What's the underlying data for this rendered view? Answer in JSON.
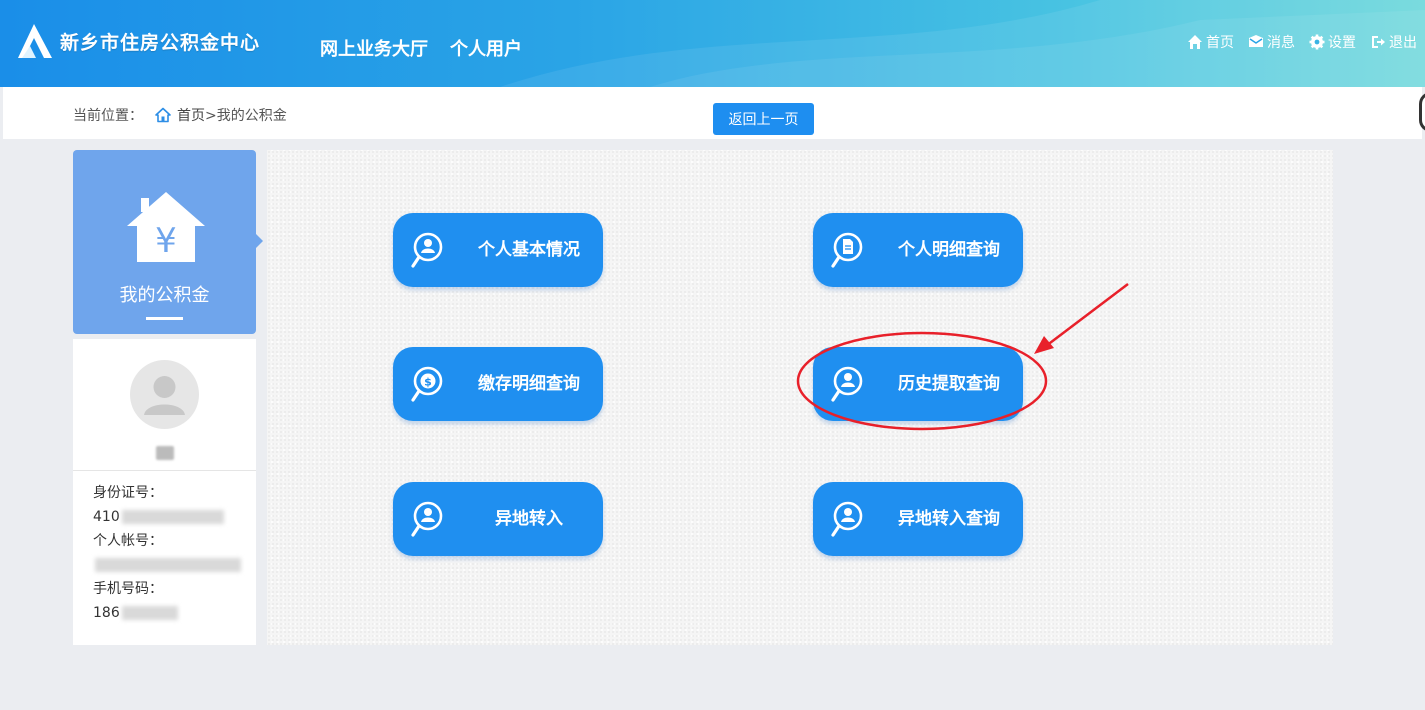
{
  "header": {
    "org_name": "新乡市住房公积金中心",
    "hall": "网上业务大厅",
    "user_type": "个人用户",
    "nav": [
      {
        "label": "首页",
        "icon": "home-icon"
      },
      {
        "label": "消息",
        "icon": "mail-icon"
      },
      {
        "label": "设置",
        "icon": "gear-icon"
      },
      {
        "label": "退出",
        "icon": "logout-icon"
      }
    ]
  },
  "breadcrumb": {
    "prefix": "当前位置：",
    "home": "首页",
    "current": " >我的公积金"
  },
  "back_button": "返回上一页",
  "sidebar": {
    "title": "我的公积金",
    "user_name_masked": "",
    "id_label": "身份证号：",
    "id_value": "410",
    "account_label": "个人帐号：",
    "account_value": "",
    "phone_label": "手机号码：",
    "phone_value": "186"
  },
  "tiles": [
    {
      "label": "个人基本情况",
      "icon": "person-search-icon"
    },
    {
      "label": "个人明细查询",
      "icon": "document-search-icon"
    },
    {
      "label": "缴存明细查询",
      "icon": "money-search-icon"
    },
    {
      "label": "历史提取查询",
      "icon": "person-search-icon"
    },
    {
      "label": "异地转入",
      "icon": "person-search-icon"
    },
    {
      "label": "异地转入查询",
      "icon": "person-search-icon"
    }
  ],
  "colors": {
    "header_start": "#1a8ee8",
    "header_end": "#6fd8dc",
    "tile": "#1f8ff0",
    "sidebar_accent": "#6fa5ec",
    "annotation": "#e8202a"
  }
}
